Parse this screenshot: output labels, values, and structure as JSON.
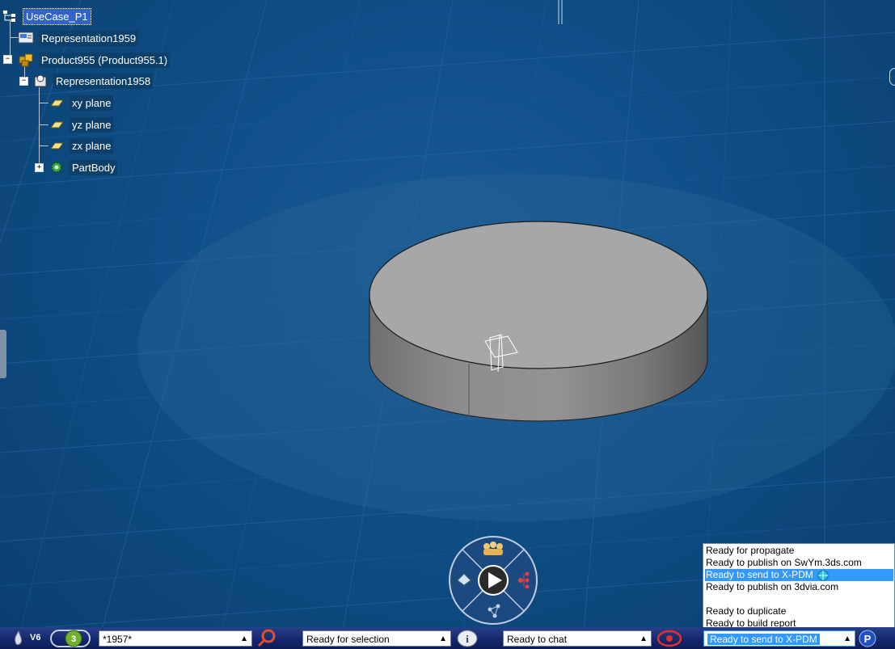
{
  "tree": {
    "root": "UseCase_P1",
    "items": [
      {
        "label": "Representation1959",
        "icon": "representation-icon"
      },
      {
        "label": "Product955 (Product955.1)",
        "icon": "product-icon"
      },
      {
        "label": "Representation1958",
        "icon": "part-representation-icon"
      },
      {
        "label": "xy plane",
        "icon": "plane-icon"
      },
      {
        "label": "yz plane",
        "icon": "plane-icon"
      },
      {
        "label": "zx plane",
        "icon": "plane-icon"
      },
      {
        "label": "PartBody",
        "icon": "partbody-gear-icon"
      }
    ]
  },
  "statusbar": {
    "logo": "V6",
    "field1": "*1957*",
    "field2": "Ready for selection",
    "field3": "Ready to chat",
    "field4": "Ready to send to X-PDM"
  },
  "popup": {
    "items": [
      "Ready for propagate",
      "Ready to publish on SwYm.3ds.com",
      "Ready to send to X-PDM",
      "Ready to publish on 3dvia.com",
      "",
      "Ready to duplicate",
      "Ready to build report"
    ],
    "selected_index": 2
  },
  "colors": {
    "background": "#0f4e86",
    "highlight": "#3399ff",
    "selection": "#3264c8"
  }
}
